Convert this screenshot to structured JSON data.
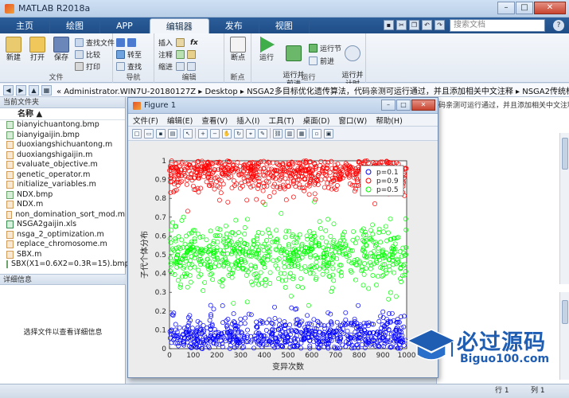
{
  "app": {
    "title": "MATLAB R2018a"
  },
  "window_buttons": {
    "minimize": "–",
    "maximize": "□",
    "close": "✕"
  },
  "ribbon_tabs": [
    "主页",
    "绘图",
    "APP",
    "编辑器",
    "发布",
    "视图"
  ],
  "active_tab": "编辑器",
  "search": {
    "placeholder": "搜索文档"
  },
  "ribbon": {
    "file_group": {
      "label": "文件",
      "new": "新建",
      "open": "打开",
      "save": "保存",
      "find_file": "查找文件",
      "compare": "比较",
      "print": "打印"
    },
    "nav_group": {
      "label": "导航",
      "goto": "转至",
      "find": "查找"
    },
    "edit_group": {
      "label": "编辑",
      "insert": "插入",
      "comment": "注释",
      "indent": "缩进",
      "fx": "fx"
    },
    "breakpoint_group": {
      "label": "断点",
      "breakpoints": "断点"
    },
    "run_group": {
      "label": "运行",
      "run": "运行",
      "run_advance": "运行并\n前进",
      "run_section": "运行节",
      "advance": "前进",
      "run_time": "运行并\n计时"
    }
  },
  "address": {
    "path": "« Administrator.WIN7U-20180127Z ▸ Desktop ▸ NSGA2多目标优化遗传算法，代码亲测可运行通过，并且添加相关中文注释 ▸ NSGA2传统标准"
  },
  "current_folder": {
    "header": "当前文件夹",
    "column": "名称 ▲",
    "files": [
      {
        "name": "bianyichuantong.bmp",
        "type": "img"
      },
      {
        "name": "bianyigaijin.bmp",
        "type": "img"
      },
      {
        "name": "duoxiangshichuantong.m",
        "type": "m"
      },
      {
        "name": "duoxiangshigaijin.m",
        "type": "m"
      },
      {
        "name": "evaluate_objective.m",
        "type": "m"
      },
      {
        "name": "genetic_operator.m",
        "type": "m"
      },
      {
        "name": "initialize_variables.m",
        "type": "m"
      },
      {
        "name": "NDX.bmp",
        "type": "img"
      },
      {
        "name": "NDX.m",
        "type": "m"
      },
      {
        "name": "non_domination_sort_mod.m",
        "type": "m"
      },
      {
        "name": "NSGA2gaijin.xls",
        "type": "xls"
      },
      {
        "name": "nsga_2_optimization.m",
        "type": "m"
      },
      {
        "name": "replace_chromosome.m",
        "type": "m"
      },
      {
        "name": "SBX.m",
        "type": "m"
      },
      {
        "name": "SBX(X1=0.6X2=0.3R=15).bmp",
        "type": "img"
      }
    ]
  },
  "details": {
    "header": "详细信息",
    "message": "选择文件以查看详细信息"
  },
  "right_panel": {
    "text": "码亲测可运行通过，并且添加相关中文注释"
  },
  "status": {
    "row_label": "行 1",
    "col_label": "列 1"
  },
  "figure": {
    "title": "Figure 1",
    "menu": [
      "文件(F)",
      "编辑(E)",
      "查看(V)",
      "插入(I)",
      "工具(T)",
      "桌面(D)",
      "窗口(W)",
      "帮助(H)"
    ],
    "buttons": {
      "minimize": "–",
      "maximize": "□",
      "close": "✕"
    }
  },
  "chart_data": {
    "type": "scatter",
    "title": "",
    "xlabel": "变异次数",
    "ylabel": "子代个体分布",
    "xlim": [
      0,
      1000
    ],
    "ylim": [
      0,
      1
    ],
    "xticks": [
      0,
      100,
      200,
      300,
      400,
      500,
      600,
      700,
      800,
      900,
      1000
    ],
    "yticks": [
      0,
      0.1,
      0.2,
      0.3,
      0.4,
      0.5,
      0.6,
      0.7,
      0.8,
      0.9,
      1
    ],
    "legend_position": "top-right",
    "marker": "open-circle",
    "series": [
      {
        "name": "p=0.1",
        "color": "#0000ff",
        "center": 0.1,
        "typical_range": [
          0,
          0.25
        ],
        "points_per_x": 1000
      },
      {
        "name": "p=0.9",
        "color": "#ff0000",
        "center": 0.9,
        "typical_range": [
          0.75,
          1.0
        ],
        "points_per_x": 1000
      },
      {
        "name": "p=0.5",
        "color": "#00ff00",
        "center": 0.5,
        "typical_range": [
          0.3,
          0.7
        ],
        "points_per_x": 1000
      }
    ]
  },
  "watermark": {
    "text": "必过源码",
    "url": "Biguo100.com"
  },
  "colors": {
    "ribbon_tab_bg": "#1f4d86",
    "accent": "#1f5db3"
  }
}
